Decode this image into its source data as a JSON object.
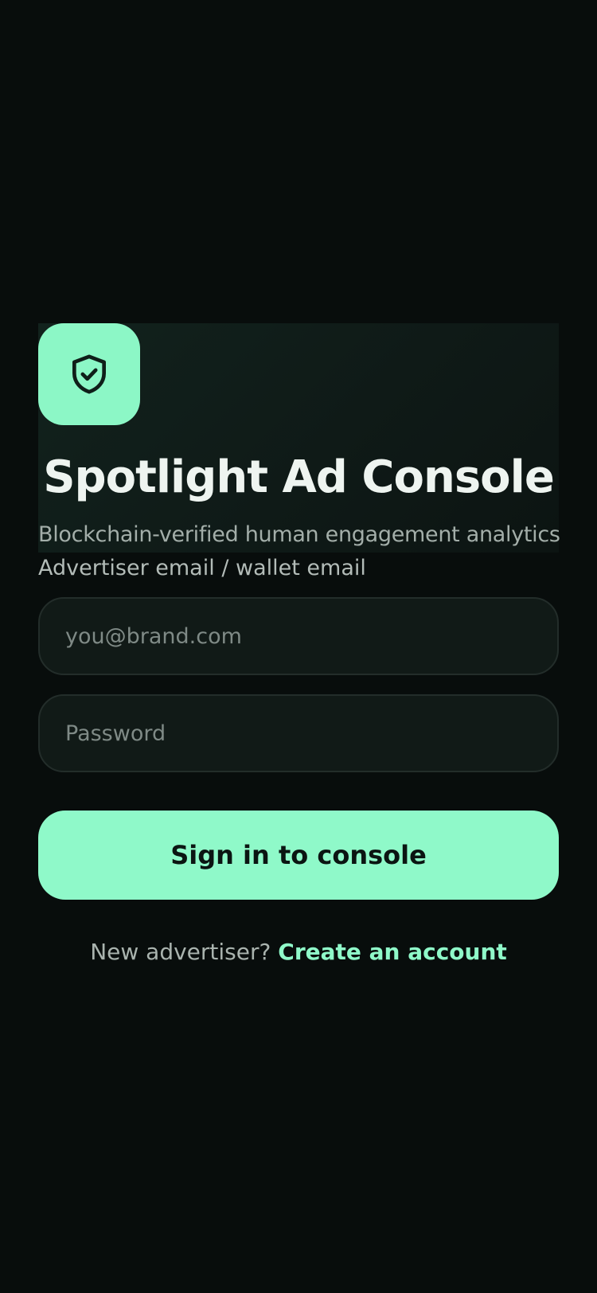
{
  "hero": {
    "logo_icon": "shield-check-icon",
    "title": "Spotlight Ad Console",
    "subtitle": "Blockchain-verified human engagement analytics"
  },
  "form": {
    "email_label": "Advertiser email / wallet email",
    "email_placeholder": "you@brand.com",
    "email_value": "",
    "password_placeholder": "Password",
    "password_value": "",
    "submit_label": "Sign in to console"
  },
  "footer": {
    "prompt": "New advertiser?",
    "link_label": "Create an account"
  },
  "colors": {
    "background": "#080d0c",
    "accent": "#8ff9c9",
    "input_background": "#111a17",
    "input_border": "#232d2a",
    "title_text": "#eef4f0",
    "muted_text": "#a3aea9"
  }
}
